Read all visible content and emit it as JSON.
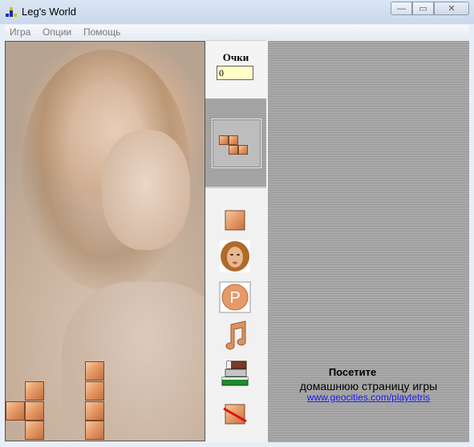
{
  "window": {
    "title": "Leg's World"
  },
  "menu": [
    "Игра",
    "Опции",
    "Помощь"
  ],
  "score": {
    "label": "Очки",
    "value": "0"
  },
  "promo": {
    "line1": "Посетите",
    "line2": "домашнюю страницу игры",
    "link": "www.geocities.com/playtetris"
  },
  "tools": [
    "square-block-icon",
    "girl-portrait-icon",
    "pause-p-icon",
    "music-note-icon",
    "books-icon",
    "no-block-icon"
  ],
  "colors": {
    "block": "#e59a68",
    "link": "#1a1aee",
    "score_bg": "#ffffc8"
  }
}
